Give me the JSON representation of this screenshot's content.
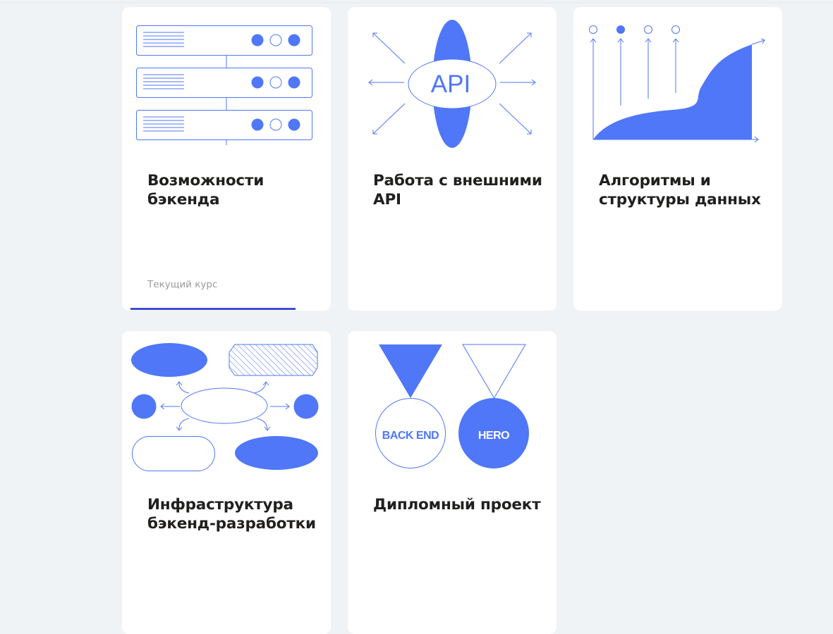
{
  "accent_color": "#4f77f7",
  "progress_color": "#3e4ed6",
  "courses": [
    {
      "title": "Возможности бэкенда",
      "status": "Текущий курс",
      "progress": 0.79,
      "illustration": "server-racks-icon"
    },
    {
      "title": "Работа с внешними API",
      "badge": "API",
      "illustration": "api-ellipse-icon"
    },
    {
      "title": "Алгоритмы и структуры данных",
      "illustration": "growth-chart-icon"
    },
    {
      "title": "Инфраструктура бэкенд-разработки",
      "illustration": "infrastructure-diagram-icon"
    },
    {
      "title": "Дипломный проект",
      "medals": [
        "BACK END",
        "HERO"
      ],
      "illustration": "medals-icon"
    }
  ]
}
